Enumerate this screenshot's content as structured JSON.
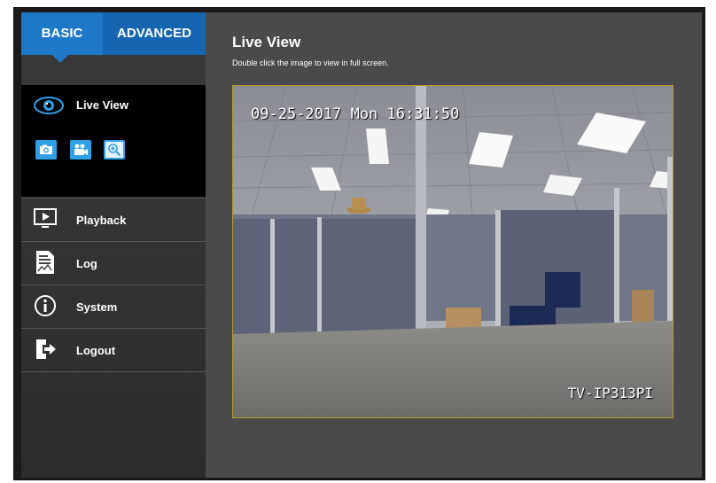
{
  "tabs": {
    "basic": "BASIC",
    "advanced": "ADVANCED"
  },
  "sidebar": {
    "live_view": "Live View",
    "tools": [
      {
        "icon": "camera-icon"
      },
      {
        "icon": "video-camera-icon"
      },
      {
        "icon": "zoom-in-icon"
      }
    ],
    "items": [
      {
        "label": "Playback",
        "icon": "playback-icon"
      },
      {
        "label": "Log",
        "icon": "log-icon"
      },
      {
        "label": "System",
        "icon": "info-icon"
      },
      {
        "label": "Logout",
        "icon": "logout-icon"
      }
    ]
  },
  "main": {
    "title": "Live View",
    "subtitle": "Double click the image to view in full screen.",
    "video": {
      "timestamp": "09-25-2017 Mon 16:31:50",
      "model": "TV-IP313PI"
    }
  },
  "colors": {
    "accent": "#1e78c8",
    "accent_dark": "#1565b0",
    "tool_blue": "#2f9fe6",
    "video_border": "#b69a2c"
  }
}
